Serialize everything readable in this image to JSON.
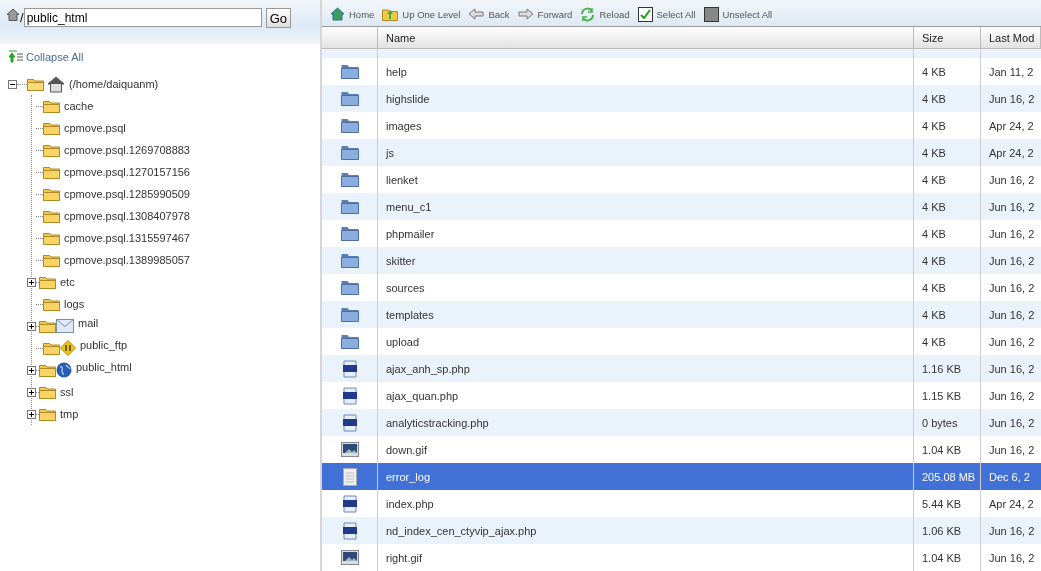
{
  "path_bar": {
    "prefix": "/",
    "value": "public_html",
    "go_button": "Go"
  },
  "collapse_all": "Collapse All",
  "tree": {
    "label": "(/home/daiquanm)",
    "expanded": true,
    "children": [
      {
        "label": "cache",
        "kind": "folder",
        "expandable": false
      },
      {
        "label": "cpmove.psql",
        "kind": "folder",
        "expandable": false
      },
      {
        "label": "cpmove.psql.1269708883",
        "kind": "folder",
        "expandable": false
      },
      {
        "label": "cpmove.psql.1270157156",
        "kind": "folder",
        "expandable": false
      },
      {
        "label": "cpmove.psql.1285990509",
        "kind": "folder",
        "expandable": false
      },
      {
        "label": "cpmove.psql.1308407978",
        "kind": "folder",
        "expandable": false
      },
      {
        "label": "cpmove.psql.1315597467",
        "kind": "folder",
        "expandable": false
      },
      {
        "label": "cpmove.psql.1389985057",
        "kind": "folder",
        "expandable": false
      },
      {
        "label": "etc",
        "kind": "folder",
        "expandable": true
      },
      {
        "label": "logs",
        "kind": "folder",
        "expandable": false
      },
      {
        "label": "mail",
        "kind": "mail",
        "expandable": true
      },
      {
        "label": "public_ftp",
        "kind": "ftp",
        "expandable": false
      },
      {
        "label": "public_html",
        "kind": "web",
        "expandable": true
      },
      {
        "label": "ssl",
        "kind": "folder",
        "expandable": true
      },
      {
        "label": "tmp",
        "kind": "folder",
        "expandable": true
      }
    ]
  },
  "toolbar": [
    {
      "label": "Home",
      "kind": "home"
    },
    {
      "label": "Up One Level",
      "kind": "up"
    },
    {
      "label": "Back",
      "kind": "back"
    },
    {
      "label": "Forward",
      "kind": "forward"
    },
    {
      "label": "Reload",
      "kind": "reload"
    },
    {
      "label": "Select All",
      "kind": "select"
    },
    {
      "label": "Unselect All",
      "kind": "unselect"
    }
  ],
  "table": {
    "columns": [
      "Name",
      "Size",
      "Last Mod"
    ],
    "rows": [
      {
        "kind": "folder",
        "name": "help",
        "size": "4 KB",
        "modified": "Jan 11, 2",
        "selected": false
      },
      {
        "kind": "folder",
        "name": "highslide",
        "size": "4 KB",
        "modified": "Jun 16, 2",
        "selected": false
      },
      {
        "kind": "folder",
        "name": "images",
        "size": "4 KB",
        "modified": "Apr 24, 2",
        "selected": false
      },
      {
        "kind": "folder",
        "name": "js",
        "size": "4 KB",
        "modified": "Apr 24, 2",
        "selected": false
      },
      {
        "kind": "folder",
        "name": "lienket",
        "size": "4 KB",
        "modified": "Jun 16, 2",
        "selected": false
      },
      {
        "kind": "folder",
        "name": "menu_c1",
        "size": "4 KB",
        "modified": "Jun 16, 2",
        "selected": false
      },
      {
        "kind": "folder",
        "name": "phpmailer",
        "size": "4 KB",
        "modified": "Jun 16, 2",
        "selected": false
      },
      {
        "kind": "folder",
        "name": "skitter",
        "size": "4 KB",
        "modified": "Jun 16, 2",
        "selected": false
      },
      {
        "kind": "folder",
        "name": "sources",
        "size": "4 KB",
        "modified": "Jun 16, 2",
        "selected": false
      },
      {
        "kind": "folder",
        "name": "templates",
        "size": "4 KB",
        "modified": "Jun 16, 2",
        "selected": false
      },
      {
        "kind": "folder",
        "name": "upload",
        "size": "4 KB",
        "modified": "Jun 16, 2",
        "selected": false
      },
      {
        "kind": "php",
        "name": "ajax_anh_sp.php",
        "size": "1.16 KB",
        "modified": "Jun 16, 2",
        "selected": false
      },
      {
        "kind": "php",
        "name": "ajax_quan.php",
        "size": "1.15 KB",
        "modified": "Jun 16, 2",
        "selected": false
      },
      {
        "kind": "php",
        "name": "analyticstracking.php",
        "size": "0 bytes",
        "modified": "Jun 16, 2",
        "selected": false
      },
      {
        "kind": "image",
        "name": "down.gif",
        "size": "1.04 KB",
        "modified": "Jun 16, 2",
        "selected": false
      },
      {
        "kind": "text",
        "name": "error_log",
        "size": "205.08 MB",
        "modified": "Dec 6, 2",
        "selected": true
      },
      {
        "kind": "php",
        "name": "index.php",
        "size": "5.44 KB",
        "modified": "Apr 24, 2",
        "selected": false
      },
      {
        "kind": "php",
        "name": "nd_index_cen_ctyvip_ajax.php",
        "size": "1.06 KB",
        "modified": "Jun 16, 2",
        "selected": false
      },
      {
        "kind": "image",
        "name": "right.gif",
        "size": "1.04 KB",
        "modified": "Jun 16, 2",
        "selected": false
      }
    ]
  }
}
